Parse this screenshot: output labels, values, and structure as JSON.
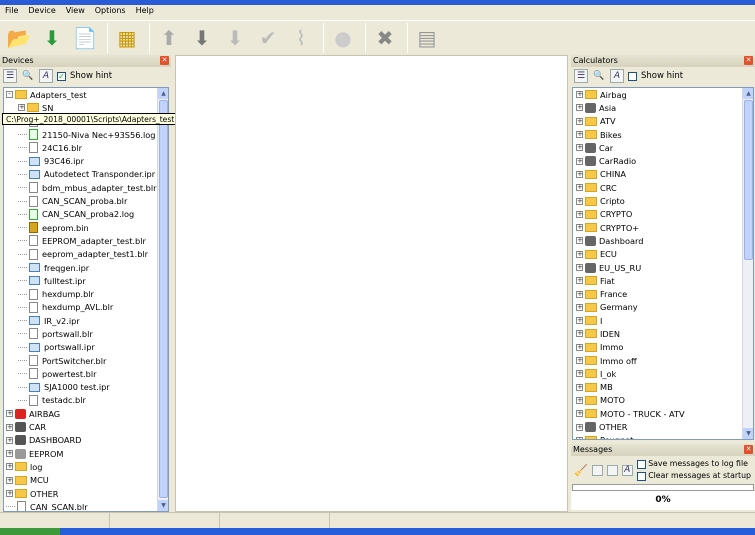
{
  "menu": [
    "File",
    "Device",
    "View",
    "Options",
    "Help"
  ],
  "toolbar": [
    "open-folder-icon",
    "download-icon",
    "new-script-icon",
    "chip-adapter-icon",
    "arrow-up-icon",
    "arrow-down-icon",
    "arrow-down-disabled-icon",
    "check-icon",
    "broom-icon",
    "circle-icon",
    "close-x-icon",
    "calculator-icon"
  ],
  "devices": {
    "title": "Devices",
    "show_hint": "Show hint",
    "tooltip": "C:\\Prog+_2018_00001\\Scripts\\Adapters_test",
    "items": [
      {
        "label": "Adapters_test",
        "level": 0,
        "type": "folder",
        "exp": "-"
      },
      {
        "label": "SN",
        "level": 1,
        "type": "folder",
        "exp": "+"
      },
      {
        "label": "",
        "level": 1,
        "type": "file"
      },
      {
        "label": "21150-Niva Nec+93S56.log",
        "level": 1,
        "type": "log"
      },
      {
        "label": "24C16.blr",
        "level": 1,
        "type": "file"
      },
      {
        "label": "93C46.ipr",
        "level": 1,
        "type": "ipr"
      },
      {
        "label": "Autodetect Transponder.ipr",
        "level": 1,
        "type": "ipr"
      },
      {
        "label": "bdm_mbus_adapter_test.blr",
        "level": 1,
        "type": "file"
      },
      {
        "label": "CAN_SCAN_proba.blr",
        "level": 1,
        "type": "file"
      },
      {
        "label": "CAN_SCAN_proba2.log",
        "level": 1,
        "type": "log"
      },
      {
        "label": "eeprom.bin",
        "level": 1,
        "type": "bin"
      },
      {
        "label": "EEPROM_adapter_test.blr",
        "level": 1,
        "type": "file"
      },
      {
        "label": "eeprom_adapter_test1.blr",
        "level": 1,
        "type": "file"
      },
      {
        "label": "freqgen.ipr",
        "level": 1,
        "type": "ipr"
      },
      {
        "label": "fulltest.ipr",
        "level": 1,
        "type": "ipr"
      },
      {
        "label": "hexdump.blr",
        "level": 1,
        "type": "file"
      },
      {
        "label": "hexdump_AVL.blr",
        "level": 1,
        "type": "file"
      },
      {
        "label": "IR_v2.ipr",
        "level": 1,
        "type": "ipr"
      },
      {
        "label": "portswall.blr",
        "level": 1,
        "type": "file"
      },
      {
        "label": "portswall.ipr",
        "level": 1,
        "type": "ipr"
      },
      {
        "label": "PortSwitcher.blr",
        "level": 1,
        "type": "file"
      },
      {
        "label": "powertest.blr",
        "level": 1,
        "type": "file"
      },
      {
        "label": "SJA1000 test.ipr",
        "level": 1,
        "type": "ipr"
      },
      {
        "label": "testadc.blr",
        "level": 1,
        "type": "file"
      },
      {
        "label": "AIRBAG",
        "level": 0,
        "type": "dev",
        "exp": "+",
        "color": "#d22"
      },
      {
        "label": "CAR",
        "level": 0,
        "type": "dev",
        "exp": "+",
        "color": "#555"
      },
      {
        "label": "DASHBOARD",
        "level": 0,
        "type": "dev",
        "exp": "+",
        "color": "#555"
      },
      {
        "label": "EEPROM",
        "level": 0,
        "type": "dev",
        "exp": "+",
        "color": "#999"
      },
      {
        "label": "log",
        "level": 0,
        "type": "folder",
        "exp": "+"
      },
      {
        "label": "MCU",
        "level": 0,
        "type": "folder",
        "exp": "+"
      },
      {
        "label": "OTHER",
        "level": 0,
        "type": "folder",
        "exp": "+"
      },
      {
        "label": "CAN_SCAN.blr",
        "level": 0,
        "type": "file"
      }
    ]
  },
  "calculators": {
    "title": "Calculators",
    "show_hint": "Show hint",
    "items": [
      {
        "label": "Airbag",
        "type": "folder"
      },
      {
        "label": "Asia",
        "type": "dev"
      },
      {
        "label": "ATV",
        "type": "folder"
      },
      {
        "label": "Bikes",
        "type": "folder"
      },
      {
        "label": "Car",
        "type": "dev"
      },
      {
        "label": "CarRadio",
        "type": "dev"
      },
      {
        "label": "CHINA",
        "type": "folder"
      },
      {
        "label": "CRC",
        "type": "folder"
      },
      {
        "label": "Cripto",
        "type": "folder"
      },
      {
        "label": "CRYPTO",
        "type": "folder"
      },
      {
        "label": "CRYPTO+",
        "type": "folder"
      },
      {
        "label": "Dashboard",
        "type": "dev"
      },
      {
        "label": "ECU",
        "type": "folder"
      },
      {
        "label": "EU_US_RU",
        "type": "dev"
      },
      {
        "label": "Fiat",
        "type": "folder"
      },
      {
        "label": "France",
        "type": "folder"
      },
      {
        "label": "Germany",
        "type": "folder"
      },
      {
        "label": "I",
        "type": "folder"
      },
      {
        "label": "IDEN",
        "type": "folder"
      },
      {
        "label": "Immo",
        "type": "folder"
      },
      {
        "label": "Immo off",
        "type": "folder"
      },
      {
        "label": "I_ok",
        "type": "folder"
      },
      {
        "label": "MB",
        "type": "folder"
      },
      {
        "label": "MOTO",
        "type": "folder"
      },
      {
        "label": "MOTO - TRUCK - ATV",
        "type": "folder"
      },
      {
        "label": "OTHER",
        "type": "dev"
      },
      {
        "label": "Peugeot",
        "type": "folder"
      }
    ]
  },
  "messages": {
    "title": "Messages",
    "save_log": "Save messages to log file",
    "clear_startup": "Clear messages at startup",
    "progress_text": "0%",
    "progress": 0
  }
}
